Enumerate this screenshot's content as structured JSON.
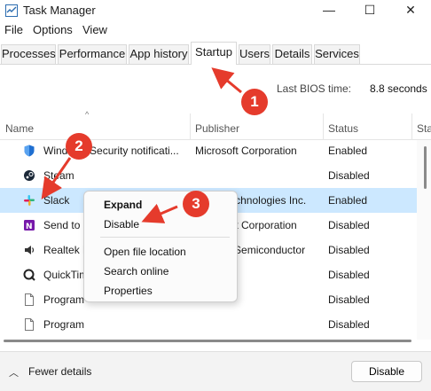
{
  "window": {
    "title": "Task Manager",
    "minimize_glyph": "—",
    "maximize_glyph": "☐",
    "close_glyph": "✕"
  },
  "menu": [
    "File",
    "Options",
    "View"
  ],
  "tabs": [
    {
      "label": "Processes"
    },
    {
      "label": "Performance"
    },
    {
      "label": "App history"
    },
    {
      "label": "Startup",
      "active": true
    },
    {
      "label": "Users"
    },
    {
      "label": "Details"
    },
    {
      "label": "Services"
    }
  ],
  "bios": {
    "label": "Last BIOS time:",
    "value": "8.8 seconds"
  },
  "columns": {
    "name": "Name",
    "publisher": "Publisher",
    "status": "Status",
    "startup_impact": "Sta"
  },
  "rows": [
    {
      "name": "Windows Security notificati...",
      "publisher": "Microsoft Corporation",
      "status": "Enabled",
      "icon": "shield-icon"
    },
    {
      "name": "Steam",
      "publisher": "",
      "status": "Disabled",
      "icon": "steam-icon"
    },
    {
      "name": "Slack",
      "publisher": "Slack Technologies Inc.",
      "status": "Enabled",
      "icon": "slack-icon",
      "selected": true
    },
    {
      "name": "Send to OneNote",
      "publisher": "Microsoft Corporation",
      "status": "Disabled",
      "icon": "onenote-icon"
    },
    {
      "name": "Realtek HD Audio",
      "publisher": "Realtek Semiconductor",
      "status": "Disabled",
      "icon": "realtek-icon"
    },
    {
      "name": "QuickTime",
      "publisher": "",
      "status": "Disabled",
      "icon": "quicktime-icon"
    },
    {
      "name": "Program",
      "publisher": "",
      "status": "Disabled",
      "icon": "file-icon"
    },
    {
      "name": "Program",
      "publisher": "",
      "status": "Disabled",
      "icon": "file-icon"
    }
  ],
  "context_menu": {
    "expand": "Expand",
    "disable": "Disable",
    "open_file_location": "Open file location",
    "search_online": "Search online",
    "properties": "Properties"
  },
  "footer": {
    "fewer_details": "Fewer details",
    "disable_button": "Disable"
  },
  "callouts": [
    "1",
    "2",
    "3"
  ],
  "colors": {
    "selection": "#cce8ff",
    "callout": "#e53b2c",
    "accent": "#0078d4"
  }
}
